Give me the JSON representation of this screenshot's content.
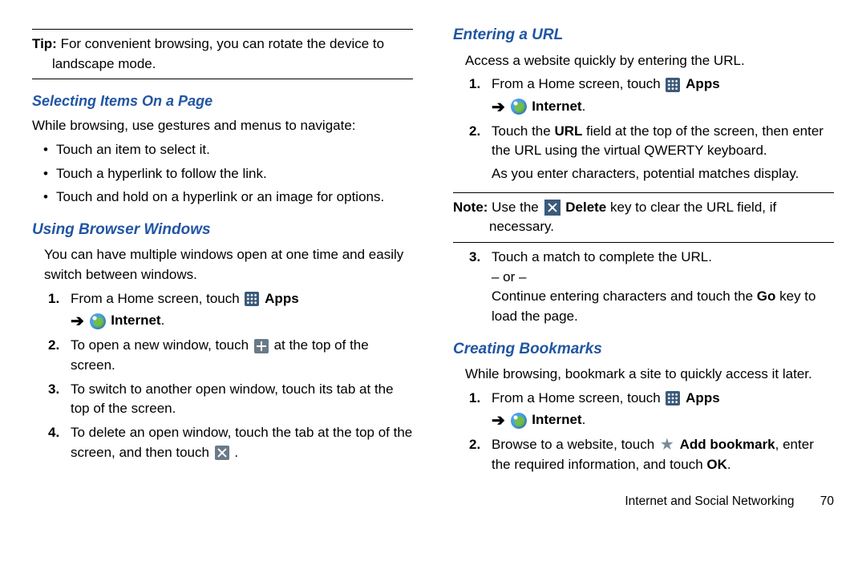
{
  "left": {
    "tip_label": "Tip:",
    "tip_text": " For convenient browsing, you can rotate the device to landscape mode.",
    "h1": "Selecting Items On a Page",
    "p1": "While browsing, use gestures and menus to navigate:",
    "bullets": [
      "Touch an item to select it.",
      "Touch a hyperlink to follow the link.",
      "Touch and hold on a hyperlink or an image for options."
    ],
    "h2": "Using Browser Windows",
    "p2": "You can have multiple windows open at one time and easily switch between windows.",
    "s1a": "From a Home screen, touch ",
    "apps": "Apps",
    "internet": "Internet",
    "s2a": "To open a new window, touch ",
    "s2b": " at the top of the screen.",
    "s3": "To switch to another open window, touch its tab at the top of the screen.",
    "s4a": "To delete an open window, touch the tab at the top of the screen, and then touch ",
    "period": "."
  },
  "right": {
    "h1": "Entering a URL",
    "p1": "Access a website quickly by entering the URL.",
    "s1a": "From a Home screen, touch ",
    "apps": "Apps",
    "internet": "Internet",
    "s2a": "Touch the ",
    "url": "URL",
    "s2b": " field at the top of the screen, then enter the URL using the virtual QWERTY keyboard.",
    "s2c": "As you enter characters, potential matches display.",
    "note_label": "Note:",
    "note_a": " Use the ",
    "delete": "Delete",
    "note_b": " key to clear the URL field, if necessary.",
    "s3a": "Touch a match to complete the URL.",
    "or": "– or –",
    "s3b": "Continue entering characters and touch the ",
    "go": "Go",
    "s3c": " key to load the page.",
    "h2": "Creating Bookmarks",
    "p2": "While browsing, bookmark a site to quickly access it later.",
    "b1a": "From a Home screen, touch ",
    "b2a": "Browse to a website, touch ",
    "addbm": "Add bookmark",
    "b2b": ", enter the required information, and touch ",
    "ok": "OK",
    "footer_text": "Internet and Social Networking",
    "page": "70"
  }
}
